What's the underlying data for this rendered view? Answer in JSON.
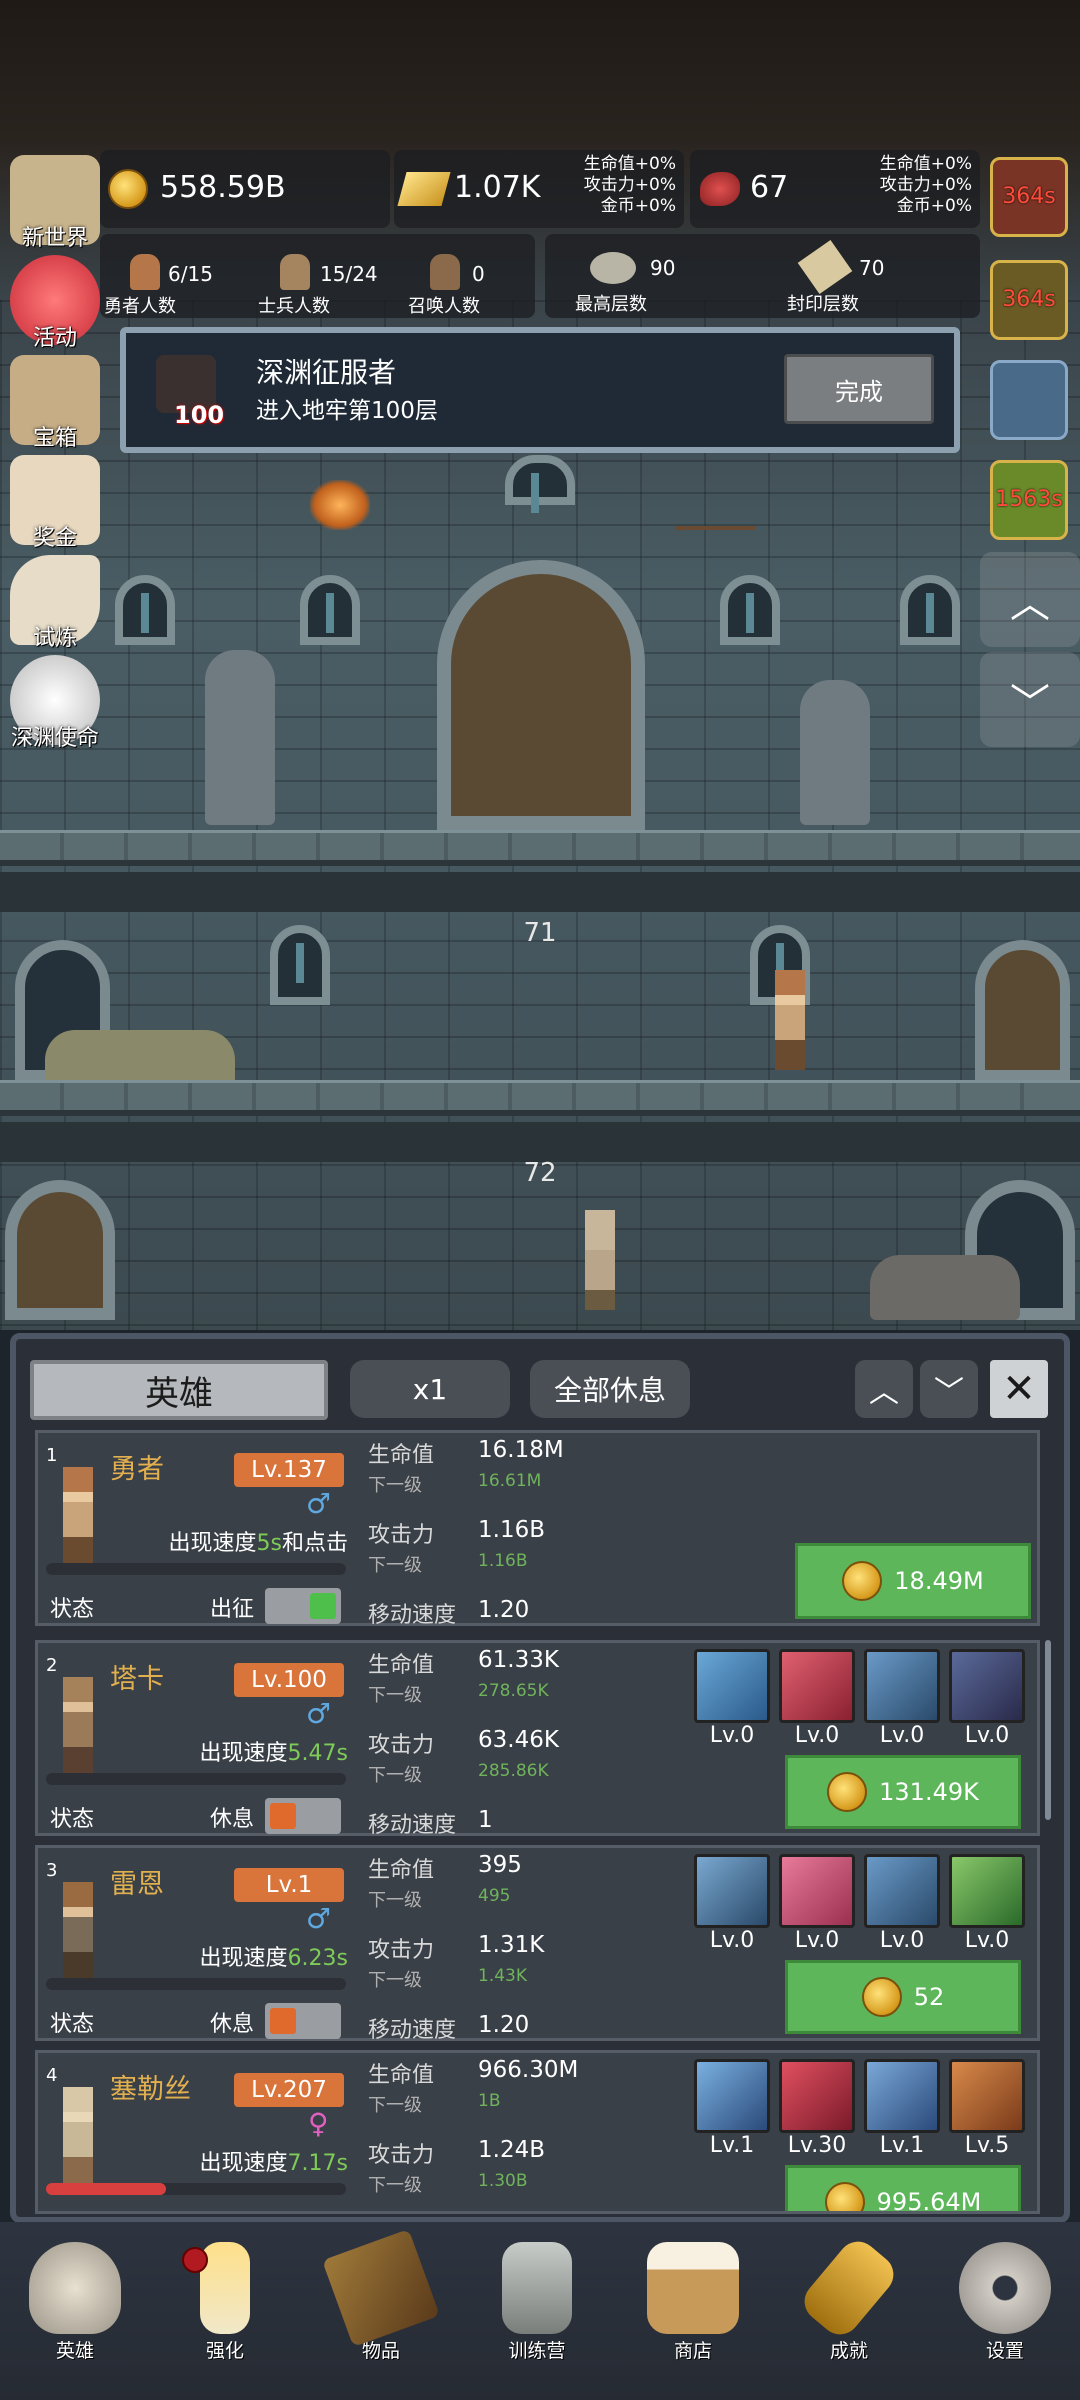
{
  "resources": {
    "gold": "558.59B",
    "bar": "1.07K",
    "meat": "67",
    "bar_bonus": [
      "生命值+0%",
      "攻击力+0%",
      "金币+0%"
    ],
    "meat_bonus": [
      "生命值+0%",
      "攻击力+0%",
      "金币+0%"
    ]
  },
  "counts": {
    "hero": {
      "value": "6/15",
      "label": "勇者人数"
    },
    "soldier": {
      "value": "15/24",
      "label": "士兵人数"
    },
    "summon": {
      "value": "0",
      "label": "召唤人数"
    },
    "max_floor": {
      "value": "90",
      "label": "最高层数"
    },
    "seal_floor": {
      "value": "70",
      "label": "封印层数"
    }
  },
  "left_menu": [
    {
      "label": "新世界",
      "icon": "map-icon"
    },
    {
      "label": "活动",
      "icon": "heart-icon"
    },
    {
      "label": "宝箱",
      "icon": "chest-icon"
    },
    {
      "label": "奖金",
      "icon": "envelope-icon"
    },
    {
      "label": "试炼",
      "icon": "wing-icon"
    },
    {
      "label": "深渊使命",
      "icon": "orb-icon"
    }
  ],
  "right_timers": [
    "364s",
    "364s",
    "",
    "1563s"
  ],
  "achievement": {
    "title": "深渊征服者",
    "desc": "进入地牢第100层",
    "badge": "100",
    "button": "完成"
  },
  "floors": [
    "71",
    "72"
  ],
  "panel": {
    "title": "英雄",
    "multiplier": "x1",
    "rest_all": "全部休息"
  },
  "heroes": [
    {
      "index": "1",
      "name": "勇者",
      "level": "Lv.137",
      "gender": "♂",
      "speed_prefix": "出现速度",
      "speed": "5s",
      "speed_suffix": "和点击",
      "hp_label": "生命值",
      "hp": "16.18M",
      "next_label": "下一级",
      "hp_next": "16.61M",
      "atk_label": "攻击力",
      "atk": "1.16B",
      "atk_next": "1.16B",
      "move_label": "移动速度",
      "move": "1.20",
      "status_label": "状态",
      "status": "出征",
      "active": true,
      "cost": "18.49M",
      "skills": []
    },
    {
      "index": "2",
      "name": "塔卡",
      "level": "Lv.100",
      "gender": "♂",
      "speed_prefix": "出现速度",
      "speed": "5.47s",
      "speed_suffix": "",
      "hp_label": "生命值",
      "hp": "61.33K",
      "next_label": "下一级",
      "hp_next": "278.65K",
      "atk_label": "攻击力",
      "atk": "63.46K",
      "atk_next": "285.86K",
      "move_label": "移动速度",
      "move": "1",
      "status_label": "状态",
      "status": "休息",
      "active": false,
      "cost": "131.49K",
      "skills": [
        "Lv.0",
        "Lv.0",
        "Lv.0",
        "Lv.0"
      ]
    },
    {
      "index": "3",
      "name": "雷恩",
      "level": "Lv.1",
      "gender": "♂",
      "speed_prefix": "出现速度",
      "speed": "6.23s",
      "speed_suffix": "",
      "hp_label": "生命值",
      "hp": "395",
      "next_label": "下一级",
      "hp_next": "495",
      "atk_label": "攻击力",
      "atk": "1.31K",
      "atk_next": "1.43K",
      "move_label": "移动速度",
      "move": "1.20",
      "status_label": "状态",
      "status": "休息",
      "active": false,
      "cost": "52",
      "skills": [
        "Lv.0",
        "Lv.0",
        "Lv.0",
        "Lv.0"
      ]
    },
    {
      "index": "4",
      "name": "塞勒丝",
      "level": "Lv.207",
      "gender": "♀",
      "speed_prefix": "出现速度",
      "speed": "7.17s",
      "speed_suffix": "",
      "hp_label": "生命值",
      "hp": "966.30M",
      "next_label": "下一级",
      "hp_next": "1B",
      "atk_label": "攻击力",
      "atk": "1.24B",
      "atk_next": "1.30B",
      "cost": "995.64M",
      "skills": [
        "Lv.1",
        "Lv.30",
        "Lv.1",
        "Lv.5"
      ]
    }
  ],
  "nav": [
    {
      "label": "英雄",
      "icon": "skull-icon"
    },
    {
      "label": "强化",
      "icon": "candle-icon"
    },
    {
      "label": "物品",
      "icon": "book-icon"
    },
    {
      "label": "训练营",
      "icon": "lantern-icon"
    },
    {
      "label": "商店",
      "icon": "beer-mug-icon"
    },
    {
      "label": "成就",
      "icon": "key-icon"
    },
    {
      "label": "设置",
      "icon": "gear-icon"
    }
  ],
  "colors": {
    "accent_green": "#5db75a",
    "level_orange": "#d9743a",
    "name_gold": "#e2b04f",
    "bonus_green": "#7ecb58"
  }
}
